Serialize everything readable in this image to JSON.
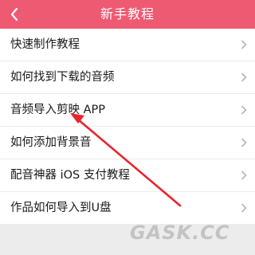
{
  "header": {
    "title": "新手教程",
    "back_icon": "chevron-left-icon",
    "color": "#ee5a72"
  },
  "tutorials": [
    {
      "label": "快速制作教程"
    },
    {
      "label": "如何找到下载的音频"
    },
    {
      "label": "音频导入剪映 APP"
    },
    {
      "label": "如何添加背景音"
    },
    {
      "label": "配音神器 iOS 支付教程"
    },
    {
      "label": "作品如何导入到U盘"
    }
  ],
  "annotation": {
    "arrow_color": "#e8242c",
    "pointing_to": "音频导入剪映 APP"
  },
  "watermark": "GASK.CC"
}
